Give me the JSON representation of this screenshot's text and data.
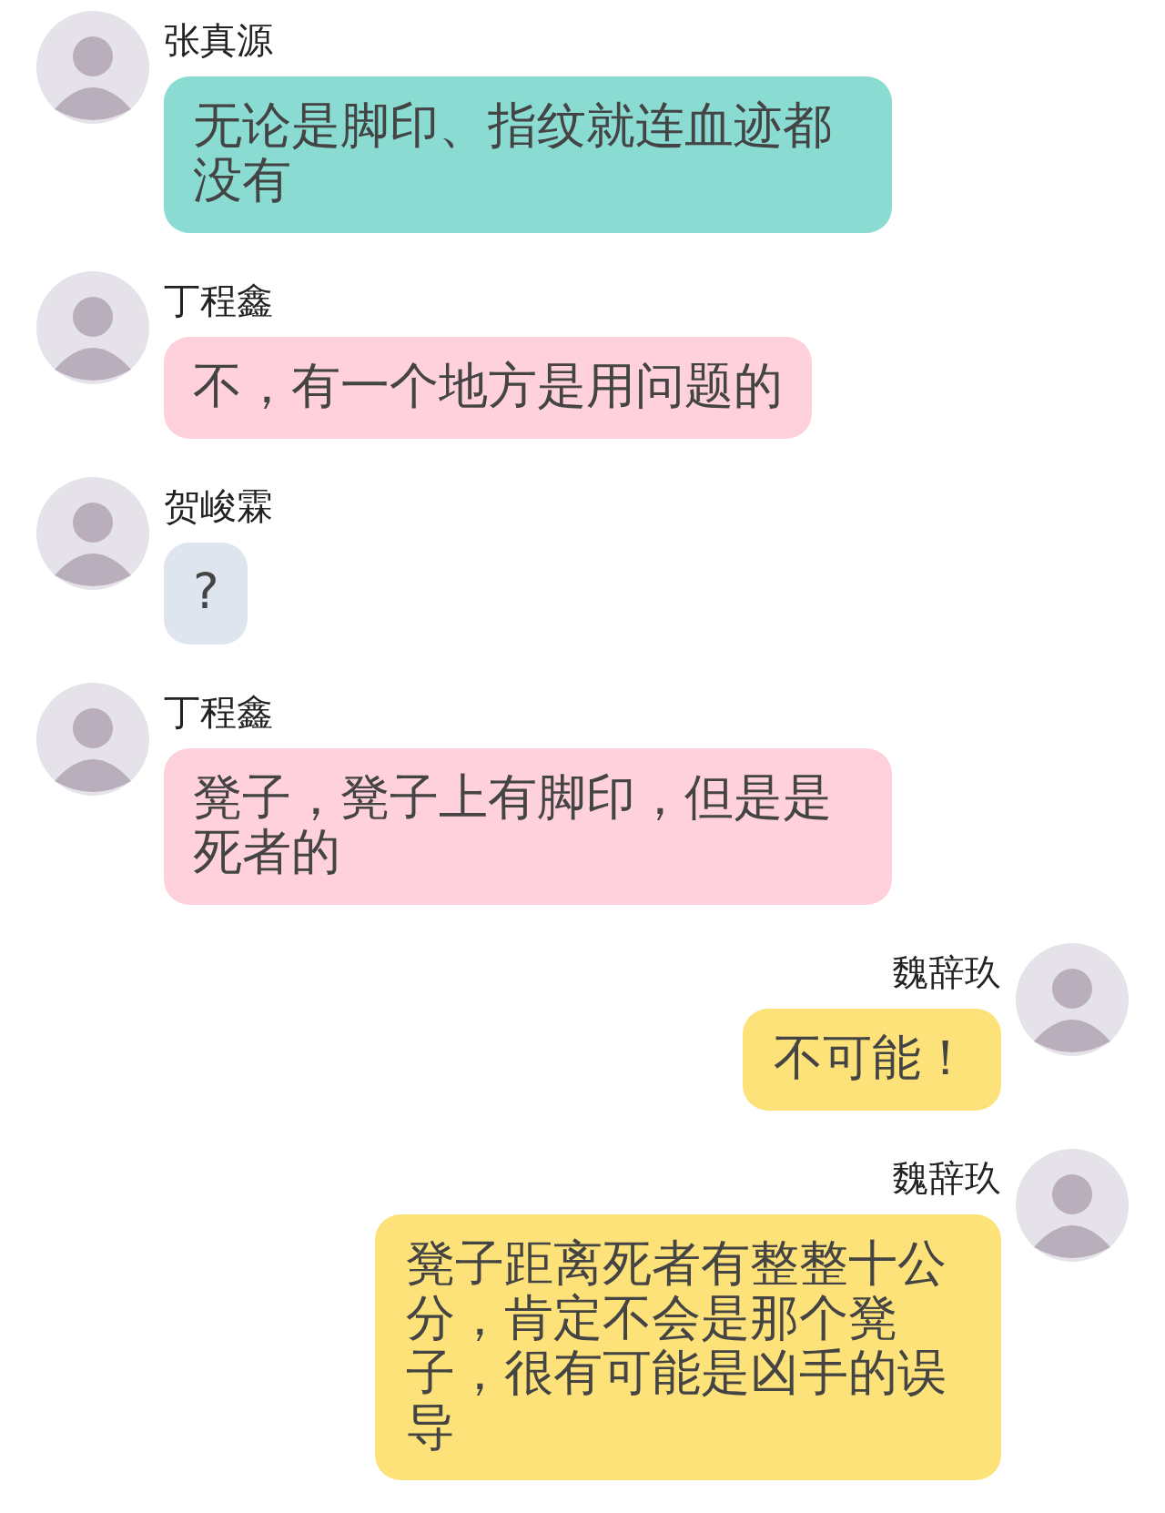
{
  "messages": [
    {
      "sender": "张真源",
      "kind": "left",
      "color": "#8adbd2",
      "text": "无论是脚印、指纹就连血迹都没有"
    },
    {
      "sender": "丁程鑫",
      "kind": "left",
      "color": "#ffd1dc",
      "text": "不，有一个地方是用问题的"
    },
    {
      "sender": "贺峻霖",
      "kind": "left",
      "color": "#dfe5ef",
      "text": "?"
    },
    {
      "sender": "丁程鑫",
      "kind": "left",
      "color": "#ffd1dc",
      "text": "凳子，凳子上有脚印，但是是死者的"
    },
    {
      "sender": "魏辞玖",
      "kind": "right",
      "color": "#fde27a",
      "text": "不可能！"
    },
    {
      "sender": "魏辞玖",
      "kind": "right",
      "color": "#fde27a",
      "text": "凳子距离死者有整整十公分，肯定不会是那个凳子，很有可能是凶手的误导"
    }
  ]
}
